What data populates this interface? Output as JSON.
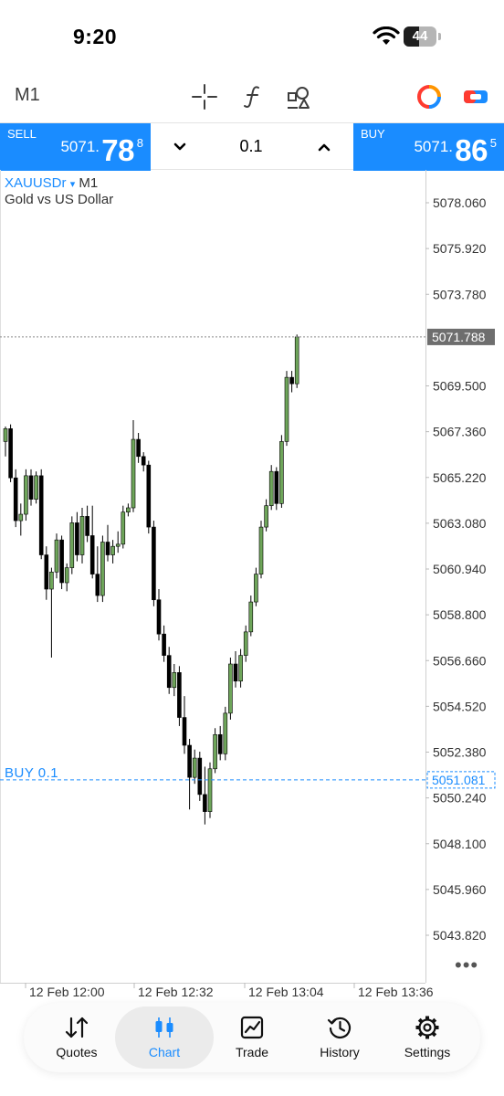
{
  "status_bar": {
    "time": "9:20",
    "battery": "44"
  },
  "toolbar": {
    "timeframe": "M1",
    "icons": [
      "crosshair-icon",
      "indicator-function-icon",
      "objects-shapes-icon",
      "account-status-icon",
      "one-click-trading-icon"
    ]
  },
  "trade_bar": {
    "sell_label": "SELL",
    "sell_price_main": "5071.",
    "sell_price_big": "78",
    "sell_price_sup": "8",
    "buy_label": "BUY",
    "buy_price_main": "5071.",
    "buy_price_big": "86",
    "buy_price_sup": "5",
    "volume": "0.1"
  },
  "chart": {
    "symbol": "XAUUSDr",
    "dropdown_mark": "▾",
    "timeframe": "M1",
    "description": "Gold vs US Dollar",
    "buy_line_label": "BUY 0.1"
  },
  "chart_data": {
    "type": "candlestick",
    "symbol": "XAUUSDr",
    "timeframe": "M1",
    "y_ticks": [
      "5078.060",
      "5075.920",
      "5073.780",
      "5069.500",
      "5067.360",
      "5065.220",
      "5063.080",
      "5060.940",
      "5058.800",
      "5056.660",
      "5054.520",
      "5052.380",
      "5050.240",
      "5048.100",
      "5045.960",
      "5043.820"
    ],
    "ylim": [
      5042.5,
      5080.0
    ],
    "x_ticks": [
      "12 Feb 12:00",
      "12 Feb 12:32",
      "12 Feb 13:04",
      "12 Feb 13:36"
    ],
    "current_price_label": "5071.788",
    "current_price": 5071.788,
    "order_line_label": "5051.081",
    "order_line_price": 5051.081,
    "up_color": "#6ea55a",
    "down_color": "#000000",
    "grid": false,
    "candles": [
      [
        5066.9,
        5067.6,
        5066.2,
        5067.5
      ],
      [
        5067.5,
        5067.7,
        5065.0,
        5065.2
      ],
      [
        5065.2,
        5065.6,
        5062.9,
        5063.2
      ],
      [
        5063.2,
        5064.0,
        5062.5,
        5063.5
      ],
      [
        5063.5,
        5065.6,
        5063.2,
        5065.3
      ],
      [
        5065.3,
        5065.6,
        5063.9,
        5064.2
      ],
      [
        5064.2,
        5065.5,
        5064.0,
        5065.3
      ],
      [
        5065.3,
        5065.6,
        5061.4,
        5061.6
      ],
      [
        5061.6,
        5062.0,
        5059.5,
        5060.0
      ],
      [
        5060.0,
        5061.0,
        5056.8,
        5060.8
      ],
      [
        5060.8,
        5062.6,
        5060.5,
        5062.3
      ],
      [
        5062.3,
        5062.5,
        5060.0,
        5060.3
      ],
      [
        5060.3,
        5061.2,
        5059.9,
        5061.0
      ],
      [
        5061.0,
        5063.4,
        5060.7,
        5063.1
      ],
      [
        5063.1,
        5063.6,
        5061.3,
        5061.6
      ],
      [
        5061.6,
        5063.8,
        5061.2,
        5063.4
      ],
      [
        5063.4,
        5063.9,
        5062.2,
        5062.5
      ],
      [
        5062.5,
        5063.9,
        5060.5,
        5060.7
      ],
      [
        5060.7,
        5062.0,
        5059.4,
        5059.7
      ],
      [
        5059.7,
        5062.5,
        5059.4,
        5062.2
      ],
      [
        5062.2,
        5063.0,
        5061.3,
        5061.6
      ],
      [
        5061.6,
        5062.3,
        5061.2,
        5062.0
      ],
      [
        5062.0,
        5062.7,
        5061.7,
        5062.1
      ],
      [
        5062.1,
        5063.9,
        5061.9,
        5063.6
      ],
      [
        5063.6,
        5064.0,
        5063.4,
        5063.8
      ],
      [
        5063.8,
        5067.9,
        5063.6,
        5067.0
      ],
      [
        5067.0,
        5067.3,
        5065.9,
        5066.2
      ],
      [
        5066.2,
        5066.4,
        5065.5,
        5065.8
      ],
      [
        5065.8,
        5066.0,
        5062.6,
        5062.9
      ],
      [
        5062.9,
        5063.2,
        5059.2,
        5059.5
      ],
      [
        5059.5,
        5060.0,
        5057.6,
        5057.9
      ],
      [
        5057.9,
        5058.3,
        5056.6,
        5056.9
      ],
      [
        5056.9,
        5057.3,
        5055.1,
        5055.4
      ],
      [
        5055.4,
        5056.5,
        5055.0,
        5056.1
      ],
      [
        5056.1,
        5056.4,
        5053.6,
        5054.0
      ],
      [
        5054.0,
        5055.0,
        5052.3,
        5052.7
      ],
      [
        5052.7,
        5053.0,
        5049.7,
        5051.2
      ],
      [
        5051.2,
        5052.5,
        5050.9,
        5052.1
      ],
      [
        5052.1,
        5052.4,
        5050.1,
        5050.4
      ],
      [
        5050.4,
        5051.7,
        5049.0,
        5049.6
      ],
      [
        5049.6,
        5051.9,
        5049.3,
        5051.6
      ],
      [
        5051.6,
        5053.5,
        5051.4,
        5053.2
      ],
      [
        5053.2,
        5053.6,
        5052.0,
        5052.3
      ],
      [
        5052.3,
        5054.5,
        5052.0,
        5054.2
      ],
      [
        5054.2,
        5056.8,
        5053.9,
        5056.5
      ],
      [
        5056.5,
        5057.1,
        5055.4,
        5055.7
      ],
      [
        5055.7,
        5057.2,
        5055.4,
        5056.9
      ],
      [
        5056.9,
        5058.3,
        5056.6,
        5058.0
      ],
      [
        5058.0,
        5059.7,
        5057.8,
        5059.4
      ],
      [
        5059.4,
        5061.0,
        5059.2,
        5060.7
      ],
      [
        5060.7,
        5063.2,
        5060.5,
        5062.9
      ],
      [
        5062.9,
        5064.2,
        5062.7,
        5063.9
      ],
      [
        5063.9,
        5065.8,
        5063.7,
        5065.5
      ],
      [
        5065.5,
        5065.7,
        5063.7,
        5064.0
      ],
      [
        5064.0,
        5067.2,
        5063.8,
        5066.9
      ],
      [
        5066.9,
        5070.2,
        5066.7,
        5069.9
      ],
      [
        5069.9,
        5070.2,
        5069.2,
        5069.6
      ],
      [
        5069.6,
        5071.9,
        5069.4,
        5071.788
      ]
    ]
  },
  "bottom_nav": {
    "items": [
      {
        "label": "Quotes",
        "icon": "quotes-arrows-icon"
      },
      {
        "label": "Chart",
        "icon": "candlestick-chart-icon"
      },
      {
        "label": "Trade",
        "icon": "trade-line-chart-icon"
      },
      {
        "label": "History",
        "icon": "history-clock-icon"
      },
      {
        "label": "Settings",
        "icon": "settings-gear-icon"
      }
    ],
    "active": "Chart",
    "active_color": "#1a8cff"
  }
}
